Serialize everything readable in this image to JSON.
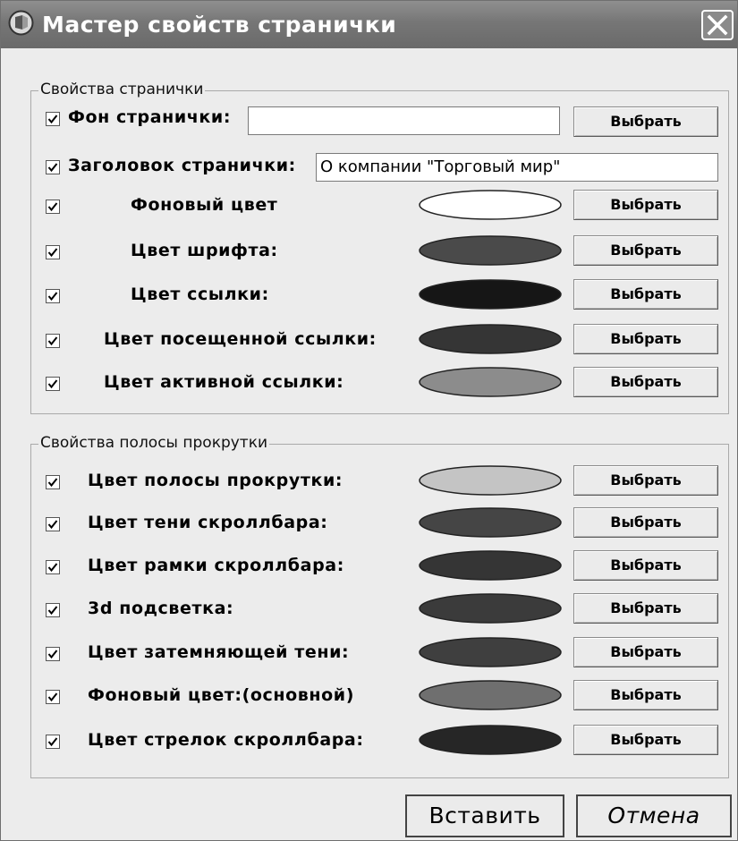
{
  "window": {
    "title": "Мастер свойств странички",
    "app_icon": "app-icon",
    "close_icon": "close-icon"
  },
  "page_group": {
    "title": "Свойства странички",
    "background": {
      "label": "Фон странички:",
      "value": "",
      "button": "Выбрать"
    },
    "header": {
      "label": "Заголовок странички:",
      "value": "О компании \"Торговый мир\""
    },
    "colors": [
      {
        "label": "Фоновый цвет",
        "color": "#ffffff",
        "button": "Выбрать"
      },
      {
        "label": "Цвет шрифта:",
        "color": "#4a4a4a",
        "button": "Выбрать"
      },
      {
        "label": "Цвет ссылки:",
        "color": "#161616",
        "button": "Выбрать"
      },
      {
        "label": "Цвет посещенной ссылки:",
        "color": "#353535",
        "button": "Выбрать"
      },
      {
        "label": "Цвет активной ссылки:",
        "color": "#8c8c8c",
        "button": "Выбрать"
      }
    ]
  },
  "scroll_group": {
    "title": "Свойства полосы прокрутки",
    "colors": [
      {
        "label": "Цвет полосы прокрутки:",
        "color": "#c4c4c4",
        "button": "Выбрать"
      },
      {
        "label": "Цвет тени скроллбара:",
        "color": "#454545",
        "button": "Выбрать"
      },
      {
        "label": "Цвет рамки скроллбара:",
        "color": "#353535",
        "button": "Выбрать"
      },
      {
        "label": "3d подсветка:",
        "color": "#3b3b3b",
        "button": "Выбрать"
      },
      {
        "label": "Цвет затемняющей тени:",
        "color": "#3f3f3f",
        "button": "Выбрать"
      },
      {
        "label": "Фоновый цвет:(основной)",
        "color": "#6f6f6f",
        "button": "Выбрать"
      },
      {
        "label": "Цвет стрелок скроллбара:",
        "color": "#262626",
        "button": "Выбрать"
      }
    ]
  },
  "footer": {
    "insert": "Вставить",
    "cancel": "Отмена"
  },
  "checkbox_checked": true
}
